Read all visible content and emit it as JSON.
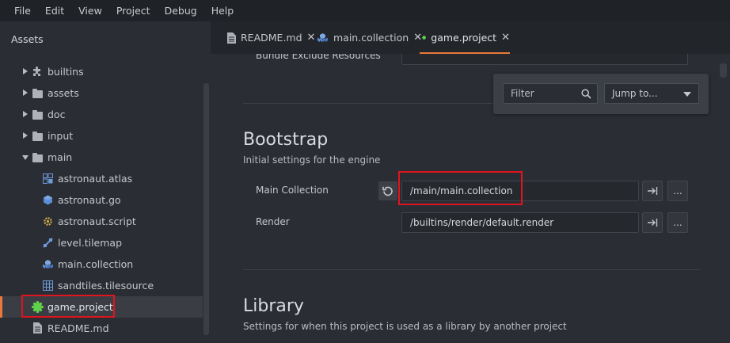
{
  "menubar": [
    "File",
    "Edit",
    "View",
    "Project",
    "Debug",
    "Help"
  ],
  "assets": {
    "title": "Assets",
    "items": [
      {
        "label": "builtins",
        "icon": "puzzle-icon",
        "kind": "collapsed-folder"
      },
      {
        "label": "assets",
        "icon": "folder-icon",
        "kind": "collapsed-folder"
      },
      {
        "label": "doc",
        "icon": "folder-icon",
        "kind": "collapsed-folder"
      },
      {
        "label": "input",
        "icon": "folder-icon",
        "kind": "collapsed-folder"
      },
      {
        "label": "main",
        "icon": "folder-icon",
        "kind": "expanded-folder"
      },
      {
        "label": "astronaut.atlas",
        "icon": "atlas-icon",
        "kind": "file"
      },
      {
        "label": "astronaut.go",
        "icon": "gameobject-icon",
        "kind": "file"
      },
      {
        "label": "astronaut.script",
        "icon": "script-gear-icon",
        "kind": "file"
      },
      {
        "label": "level.tilemap",
        "icon": "tilemap-icon",
        "kind": "file"
      },
      {
        "label": "main.collection",
        "icon": "collection-icon",
        "kind": "file"
      },
      {
        "label": "sandtiles.tilesource",
        "icon": "tilesource-icon",
        "kind": "file"
      },
      {
        "label": "game.project",
        "icon": "defold-project-icon",
        "kind": "file-selected"
      },
      {
        "label": "README.md",
        "icon": "document-icon",
        "kind": "file"
      }
    ]
  },
  "tabs": [
    {
      "label": "README.md",
      "icon": "document-icon"
    },
    {
      "label": "main.collection",
      "icon": "collection-icon"
    },
    {
      "label": "game.project",
      "icon": "defold-project-icon",
      "active": true
    }
  ],
  "editor": {
    "partial_label": "Bundle Exclude Resources",
    "bootstrap": {
      "title": "Bootstrap",
      "subtitle": "Initial settings for the engine",
      "main_collection_label": "Main Collection",
      "main_collection_value": "/main/main.collection",
      "render_label": "Render",
      "render_value": "/builtins/render/default.render",
      "more_label": "..."
    },
    "library": {
      "title": "Library",
      "subtitle": "Settings for when this project is used as a library by another project"
    },
    "filter": {
      "placeholder": "Filter",
      "jump_label": "Jump to..."
    }
  },
  "colors": {
    "accent": "#e8793a",
    "highlight": "#e0141e",
    "defold_green": "#5fd14a",
    "collection_blue": "#5b8ed6"
  }
}
